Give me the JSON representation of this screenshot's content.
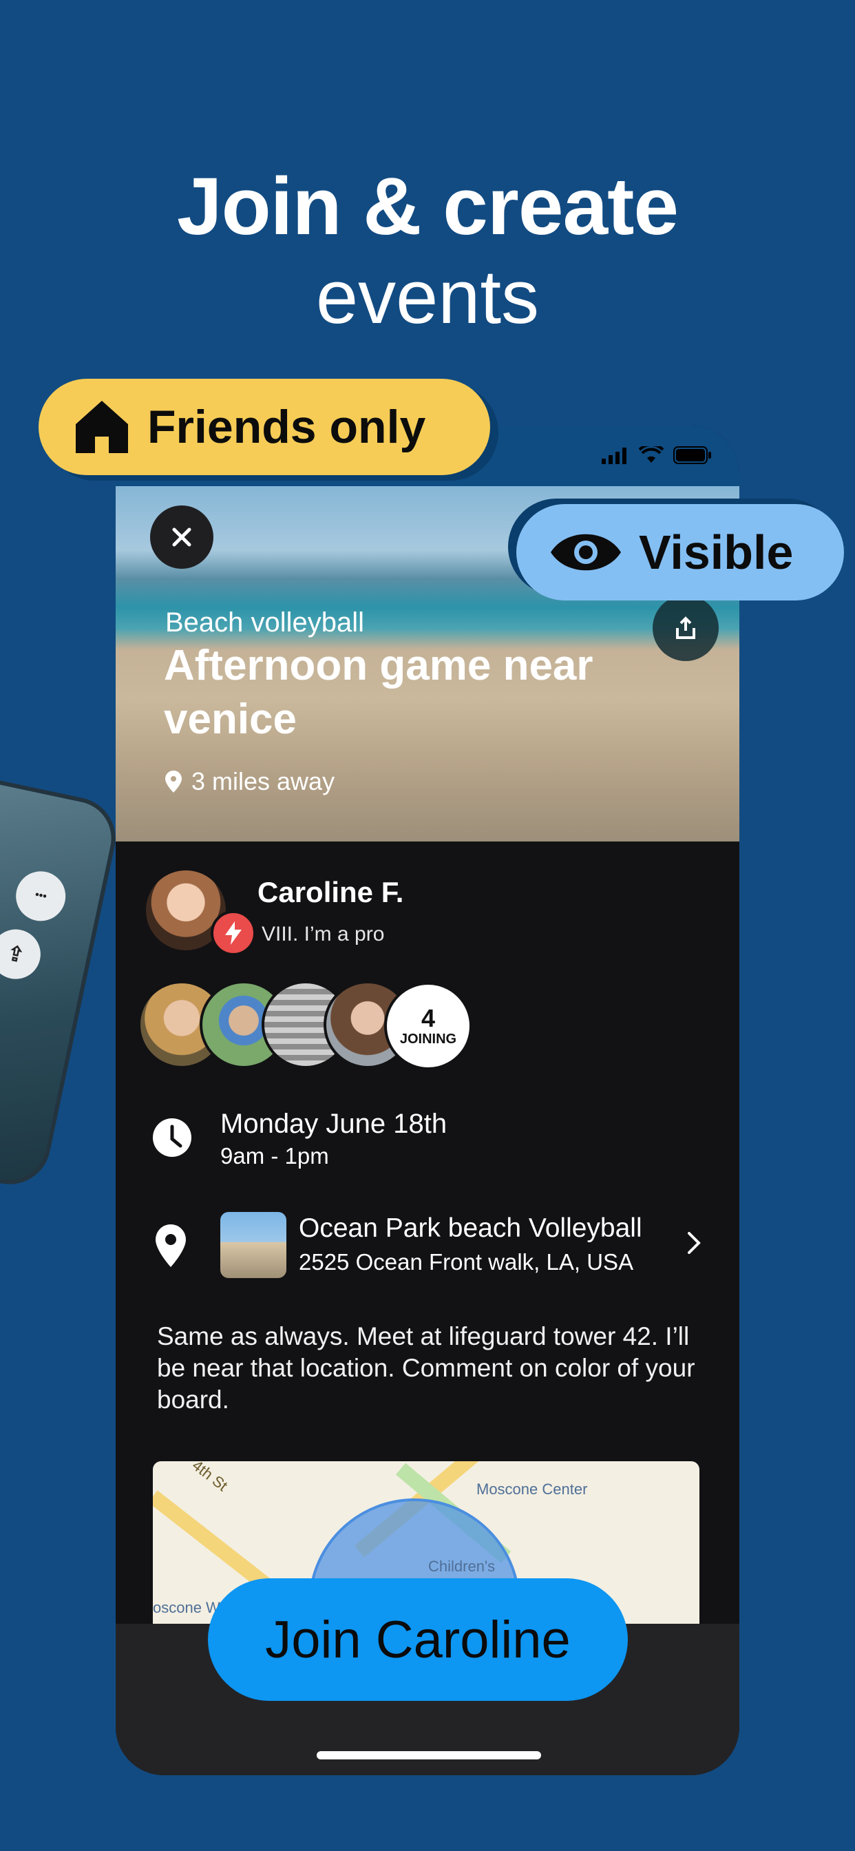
{
  "headline": {
    "line1": "Join & create",
    "line2": "events"
  },
  "badges": {
    "friends_only": "Friends only",
    "visible": "Visible"
  },
  "event": {
    "category": "Beach volleyball",
    "title": "Afternoon game near venice",
    "distance": "3 miles away"
  },
  "host": {
    "name": "Caroline F.",
    "subtitle": "VIII. I’m a pro"
  },
  "attendees": {
    "count": "4",
    "label": "JOINING"
  },
  "schedule": {
    "date": "Monday June 18th",
    "time": "9am - 1pm"
  },
  "location": {
    "name": "Ocean Park beach Volleyball",
    "address": "2525 Ocean Front walk, LA, USA"
  },
  "description": "Same as always. Meet at lifeguard tower 42. I’ll be near that location. Comment on color of your board.",
  "map": {
    "label1": "Moscone Center",
    "label2": "Children's",
    "label3": "4th St",
    "label4": "oscone W"
  },
  "cta": {
    "join_label": "Join Caroline"
  },
  "colors": {
    "background": "#124b82",
    "friends_pill": "#f6cc56",
    "visible_pill": "#84bff3",
    "join_button": "#0d96f2"
  }
}
